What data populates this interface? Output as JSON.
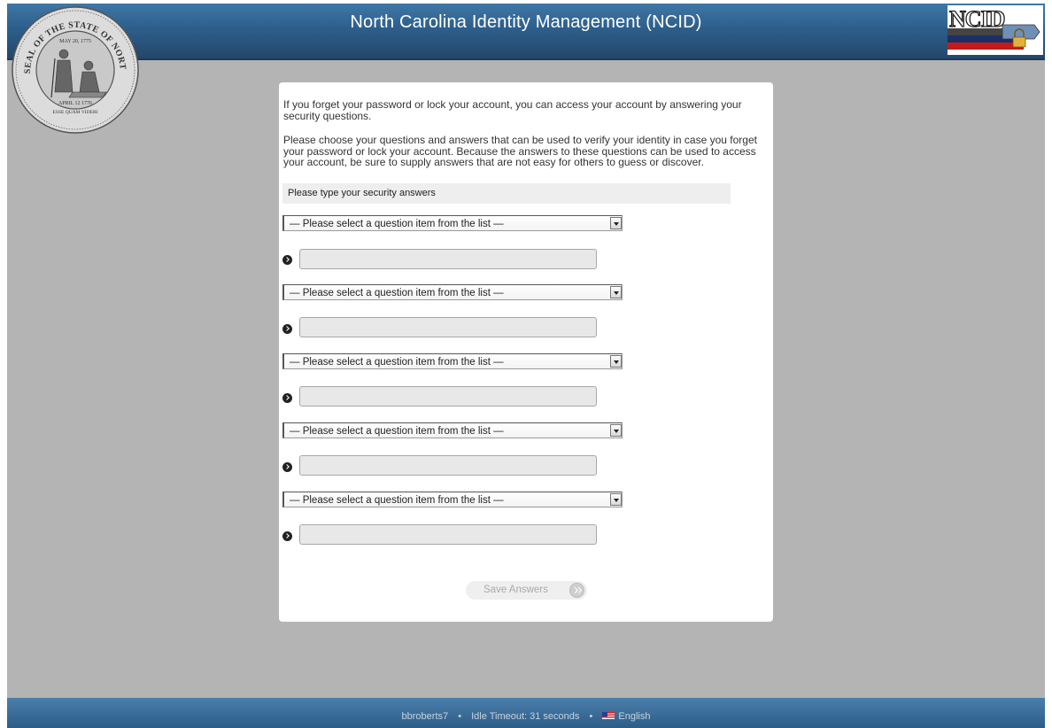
{
  "header": {
    "title": "North Carolina Identity Management (NCID)"
  },
  "seal": {
    "text_top": "THE GREAT SEAL OF THE STATE OF NORTH CAROLINA",
    "date_top": "MAY 20, 1775",
    "date_bottom": "APRIL 12 1776",
    "motto": "ESSE QUAM VIDERI"
  },
  "logo": {
    "text": "NCID"
  },
  "intro": {
    "p1": "If you forget your password or lock your account, you can access your account by answering your security questions.",
    "p2": "Please choose your questions and answers that can be used to verify your identity in case you forget your password or lock your account. Because the answers to these questions can be used to access your account, be sure to supply answers that are not easy for others to guess or discover."
  },
  "section_label": "Please type your security answers",
  "questions": [
    {
      "select_value": "— Please select a question item from the list —",
      "answer": ""
    },
    {
      "select_value": "— Please select a question item from the list —",
      "answer": ""
    },
    {
      "select_value": "— Please select a question item from the list —",
      "answer": ""
    },
    {
      "select_value": "— Please select a question item from the list —",
      "answer": ""
    },
    {
      "select_value": "— Please select a question item from the list —",
      "answer": ""
    }
  ],
  "save_button": "Save Answers",
  "footer": {
    "user": "bbroberts7",
    "idle_timeout": "Idle Timeout: 31 seconds",
    "language": "English",
    "separator": "•"
  }
}
